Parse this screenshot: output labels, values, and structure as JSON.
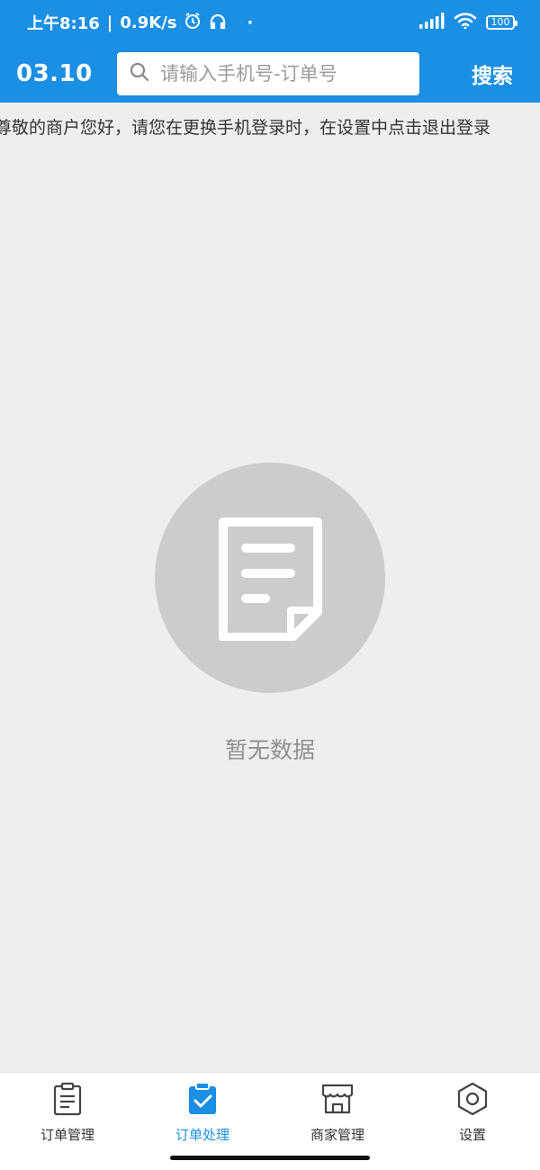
{
  "status_bar": {
    "time": "上午8:16",
    "separator": "|",
    "net_speed": "0.9K/s",
    "dot": "·",
    "battery": "100"
  },
  "header": {
    "date": "03.10",
    "search_placeholder": "请输入手机号-订单号",
    "search_button": "搜索"
  },
  "notice": {
    "text": "尊敬的商户您好，请您在更换手机登录时，在设置中点击退出登录"
  },
  "empty_state": {
    "text": "暂无数据"
  },
  "tabbar": {
    "tabs": [
      {
        "label": "订单管理",
        "icon": "clipboard-list-icon",
        "active": false
      },
      {
        "label": "订单处理",
        "icon": "clipboard-check-icon",
        "active": true
      },
      {
        "label": "商家管理",
        "icon": "storefront-icon",
        "active": false
      },
      {
        "label": "设置",
        "icon": "gear-icon",
        "active": false
      }
    ]
  },
  "colors": {
    "primary": "#1a8fe3",
    "background": "#eeeeee",
    "empty_circle": "#cccccc",
    "empty_text": "#8f8f8f"
  }
}
